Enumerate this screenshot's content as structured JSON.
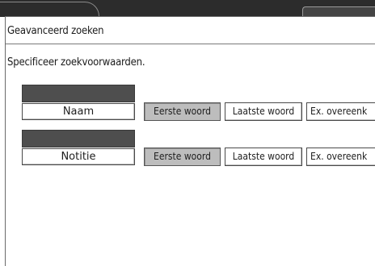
{
  "window": {
    "title": "Geavanceerd zoeken"
  },
  "instruction": "Specificeer zoekvoorwaarden.",
  "criteria": [
    {
      "field_label": "Naam",
      "value": "",
      "options": [
        {
          "label": "Eerste woord",
          "selected": true
        },
        {
          "label": "Laatste woord",
          "selected": false
        },
        {
          "label": "Ex. overeenk",
          "selected": false
        }
      ]
    },
    {
      "field_label": "Notitie",
      "value": "",
      "options": [
        {
          "label": "Eerste woord",
          "selected": true
        },
        {
          "label": "Laatste woord",
          "selected": false
        },
        {
          "label": "Ex. overeenk",
          "selected": false
        }
      ]
    }
  ],
  "colors": {
    "top_bar": "#2c2c2c",
    "value_box": "#4e4e4e",
    "selected_option": "#bdbdbd",
    "background": "#ffffff"
  }
}
